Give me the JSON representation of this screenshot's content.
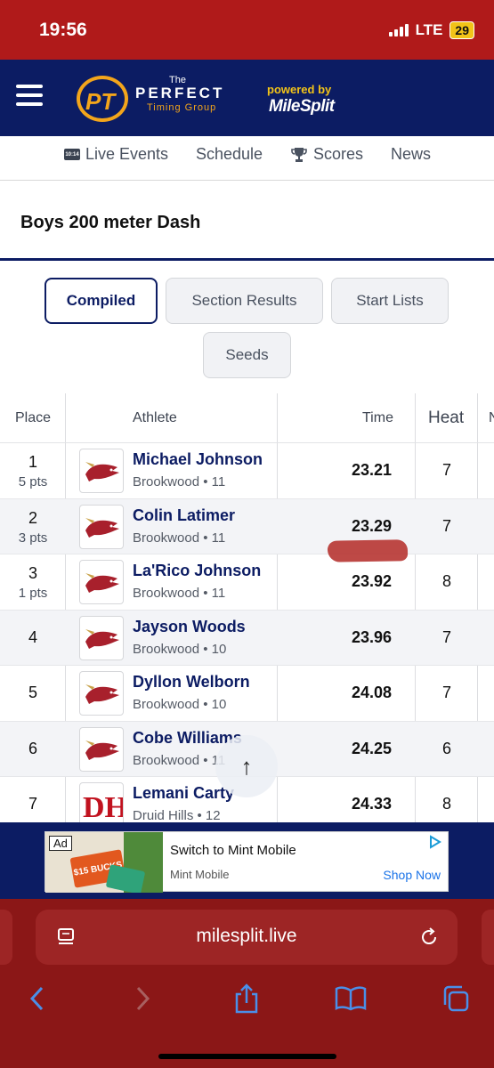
{
  "status_bar": {
    "time": "19:56",
    "network": "LTE",
    "battery": "29"
  },
  "header": {
    "logo_the": "The",
    "logo_perfect": "PERFECT",
    "logo_timing": "Timing Group",
    "powered_by": "powered by",
    "milesplit": "MileSplit"
  },
  "nav": [
    {
      "label": "Live Events",
      "icon": "live-clock-icon"
    },
    {
      "label": "Schedule"
    },
    {
      "label": "Scores",
      "icon": "trophy-icon"
    },
    {
      "label": "News"
    }
  ],
  "event": {
    "title": "Boys 200 meter Dash"
  },
  "tabs": [
    {
      "label": "Compiled",
      "active": true
    },
    {
      "label": "Section Results"
    },
    {
      "label": "Start Lists"
    },
    {
      "label": "Seeds"
    }
  ],
  "table": {
    "columns": {
      "place": "Place",
      "athlete": "Athlete",
      "time": "Time",
      "heat": "Heat",
      "next": "N"
    },
    "rows": [
      {
        "place": "1",
        "pts": "5 pts",
        "name": "Michael Johnson",
        "school": "Brookwood • 11",
        "time": "23.21",
        "heat": "7",
        "logo": "brookwood-logo"
      },
      {
        "place": "2",
        "pts": "3 pts",
        "name": "Colin Latimer",
        "school": "Brookwood • 11",
        "time": "23.29",
        "heat": "7",
        "logo": "brookwood-logo"
      },
      {
        "place": "3",
        "pts": "1 pts",
        "name": "La'Rico Johnson",
        "school": "Brookwood • 11",
        "time": "23.92",
        "heat": "8",
        "logo": "brookwood-logo"
      },
      {
        "place": "4",
        "pts": "",
        "name": "Jayson Woods",
        "school": "Brookwood • 10",
        "time": "23.96",
        "heat": "7",
        "logo": "brookwood-logo"
      },
      {
        "place": "5",
        "pts": "",
        "name": "Dyllon Welborn",
        "school": "Brookwood • 10",
        "time": "24.08",
        "heat": "7",
        "logo": "brookwood-logo"
      },
      {
        "place": "6",
        "pts": "",
        "name": "Cobe Williams",
        "school": "Brookwood • 11",
        "time": "24.25",
        "heat": "6",
        "logo": "brookwood-logo"
      },
      {
        "place": "7",
        "pts": "",
        "name": "Lemani Carty",
        "school": "Druid Hills • 12",
        "time": "24.33",
        "heat": "8",
        "logo": "druid-hills-logo"
      }
    ]
  },
  "ad": {
    "badge": "Ad",
    "promo": "$15 BUCKS",
    "headline": "Switch to Mint Mobile",
    "advertiser": "Mint Mobile",
    "cta": "Shop Now"
  },
  "browser": {
    "url": "milesplit.live"
  },
  "colors": {
    "brand_navy": "#0c1c63",
    "status_red": "#b01a1a",
    "browser_red": "#8b1717",
    "accent_gold": "#f3a51b"
  }
}
